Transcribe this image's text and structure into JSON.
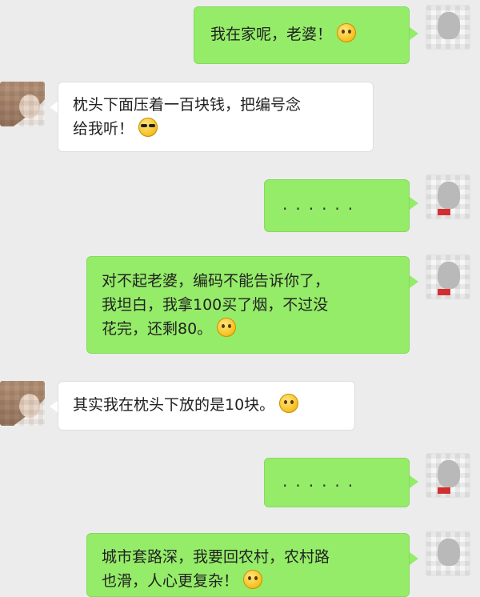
{
  "messages": [
    {
      "side": "right",
      "text": "我在家呢，老婆！",
      "emoji": "smile-emoji"
    },
    {
      "side": "left",
      "line1": "枕头下面压着一百块钱，把编号念",
      "line2": "给我听！",
      "emoji": "sunglasses-emoji"
    },
    {
      "side": "right",
      "text": "......"
    },
    {
      "side": "right",
      "line1": "对不起老婆，编码不能告诉你了，",
      "line2": "我坦白，我拿100买了烟，不过没",
      "line3": "花完，还剩80。",
      "emoji": "nervous-emoji"
    },
    {
      "side": "left",
      "text": "其实我在枕头下放的是10块。",
      "emoji": "tongue-emoji"
    },
    {
      "side": "right",
      "text": "......"
    },
    {
      "side": "right",
      "line1": "城市套路深，我要回农村，农村路",
      "line2": "也滑，人心更复杂！",
      "emoji": "smirk-emoji"
    }
  ],
  "colors": {
    "background": "#ececec",
    "sent_bubble": "#95ec69",
    "received_bubble": "#ffffff"
  }
}
